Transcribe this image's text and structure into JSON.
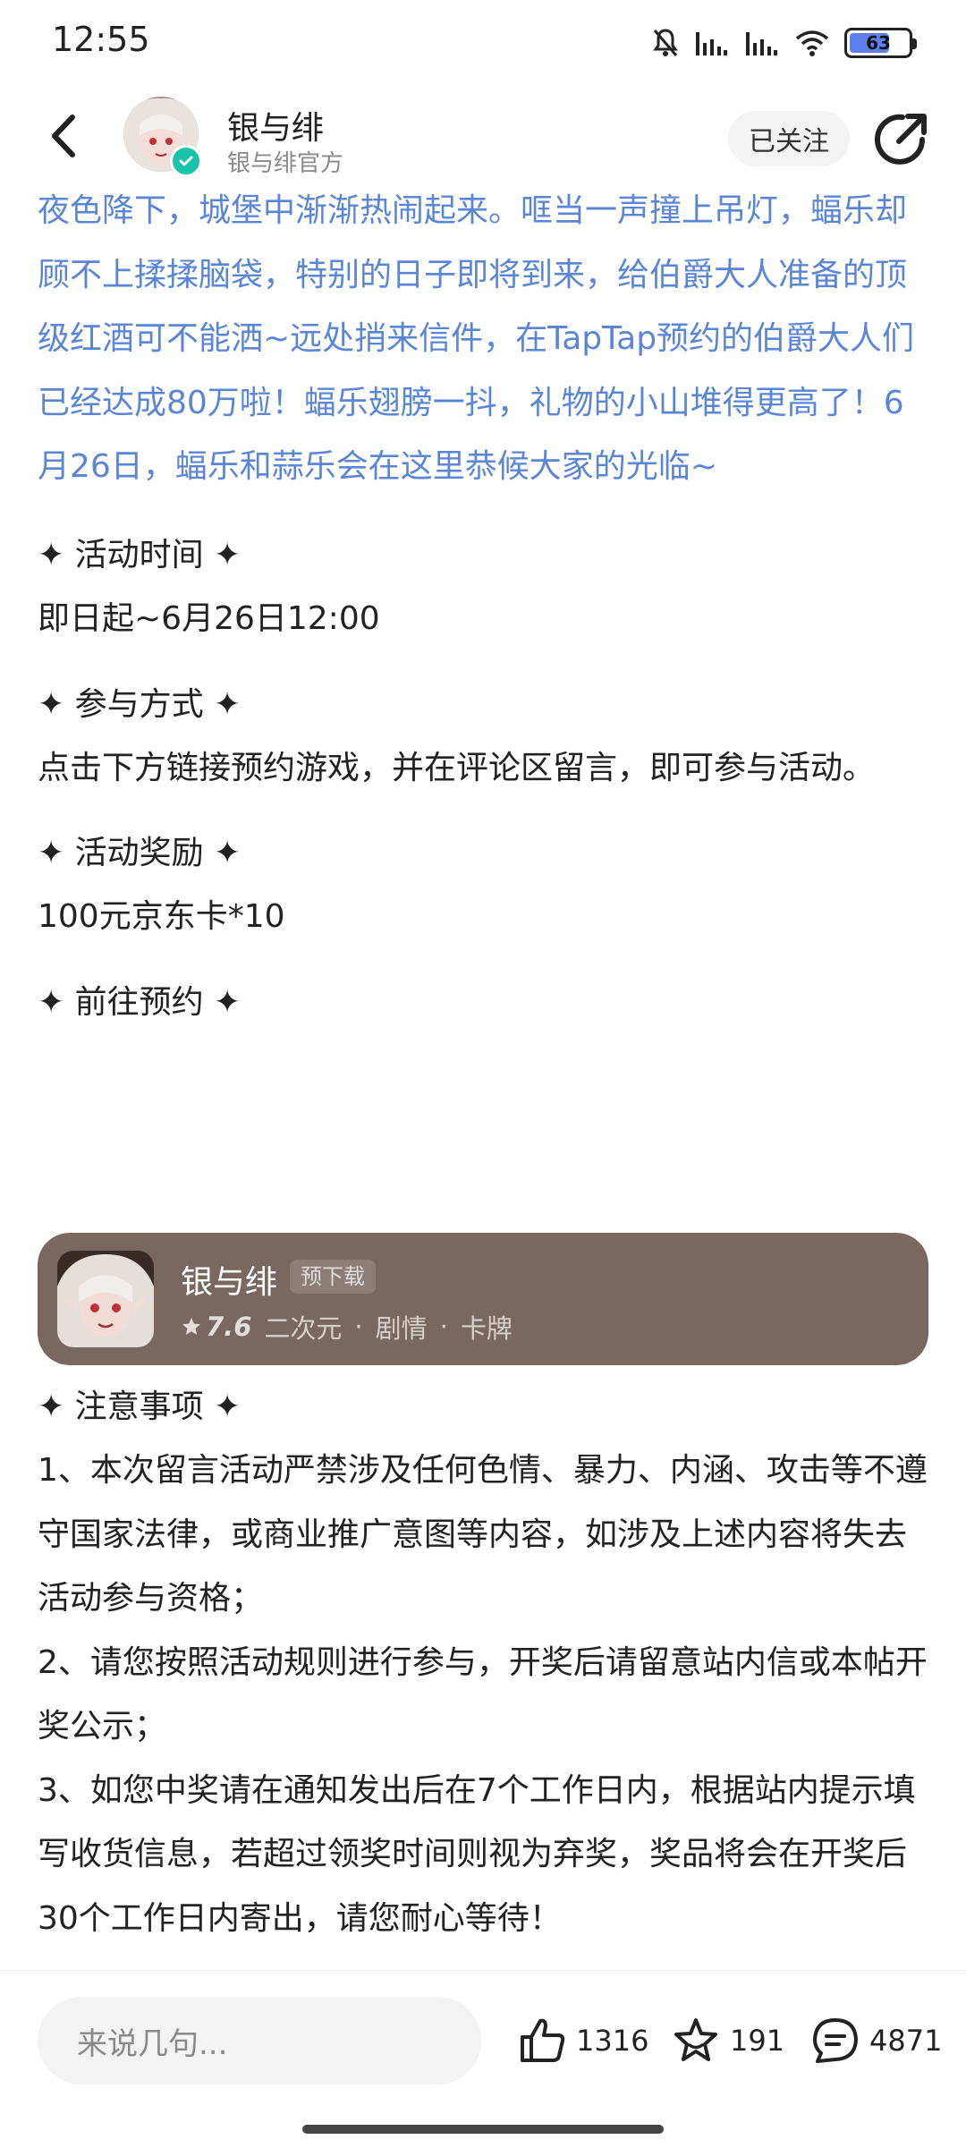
{
  "status_bar": {
    "time": "12:55",
    "battery": "63"
  },
  "header": {
    "author_name": "银与绯",
    "author_subtitle": "银与绯官方",
    "follow_label": "已关注"
  },
  "post": {
    "intro": "夜色降下，城堡中渐渐热闹起来。哐当一声撞上吊灯，蝠乐却顾不上揉揉脑袋，特别的日子即将到来，给伯爵大人准备的顶级红酒可不能洒~远处捎来信件，在TapTap预约的伯爵大人们已经达成80万啦！蝠乐翅膀一抖，礼物的小山堆得更高了！6月26日，蝠乐和蒜乐会在这里恭候大家的光临~",
    "sections": [
      {
        "title": "✦ 活动时间 ✦",
        "body": "即日起~6月26日12:00"
      },
      {
        "title": "✦ 参与方式 ✦",
        "body": "点击下方链接预约游戏，并在评论区留言，即可参与活动。"
      },
      {
        "title": "✦ 活动奖励 ✦",
        "body": "100元京东卡*10"
      },
      {
        "title": "✦ 前往预约 ✦",
        "body": ""
      },
      {
        "title": "✦ 注意事项 ✦",
        "body": ""
      }
    ],
    "notes": [
      "1、本次留言活动严禁涉及任何色情、暴力、内涵、攻击等不遵守国家法律，或商业推广意图等内容，如涉及上述内容将失去活动参与资格；",
      "2、请您按照活动规则进行参与，开奖后请留意站内信或本帖开奖公示；",
      "3、如您中奖请在通知发出后在7个工作日内，根据站内提示填写收货信息，若超过领奖时间则视为弃奖，奖品将会在开奖后30个工作日内寄出，请您耐心等待！"
    ]
  },
  "game_card": {
    "name": "银与绯",
    "tag": "预下载",
    "rating": "7.6",
    "genres": [
      "二次元",
      "剧情",
      "卡牌"
    ],
    "separator": "·"
  },
  "bottom_bar": {
    "comment_placeholder": "来说几句...",
    "likes": "1316",
    "favorites": "191",
    "comments": "4871"
  },
  "colors": {
    "intro_text": "#5b86d6",
    "card_bg": "#7a6860",
    "verified": "#19c3a8"
  },
  "icons": [
    "back-arrow-icon",
    "share-icon",
    "thumbs-up-icon",
    "star-icon",
    "comment-icon",
    "verified-icon",
    "mute-icon",
    "signal-icon",
    "wifi-icon",
    "battery-icon"
  ]
}
